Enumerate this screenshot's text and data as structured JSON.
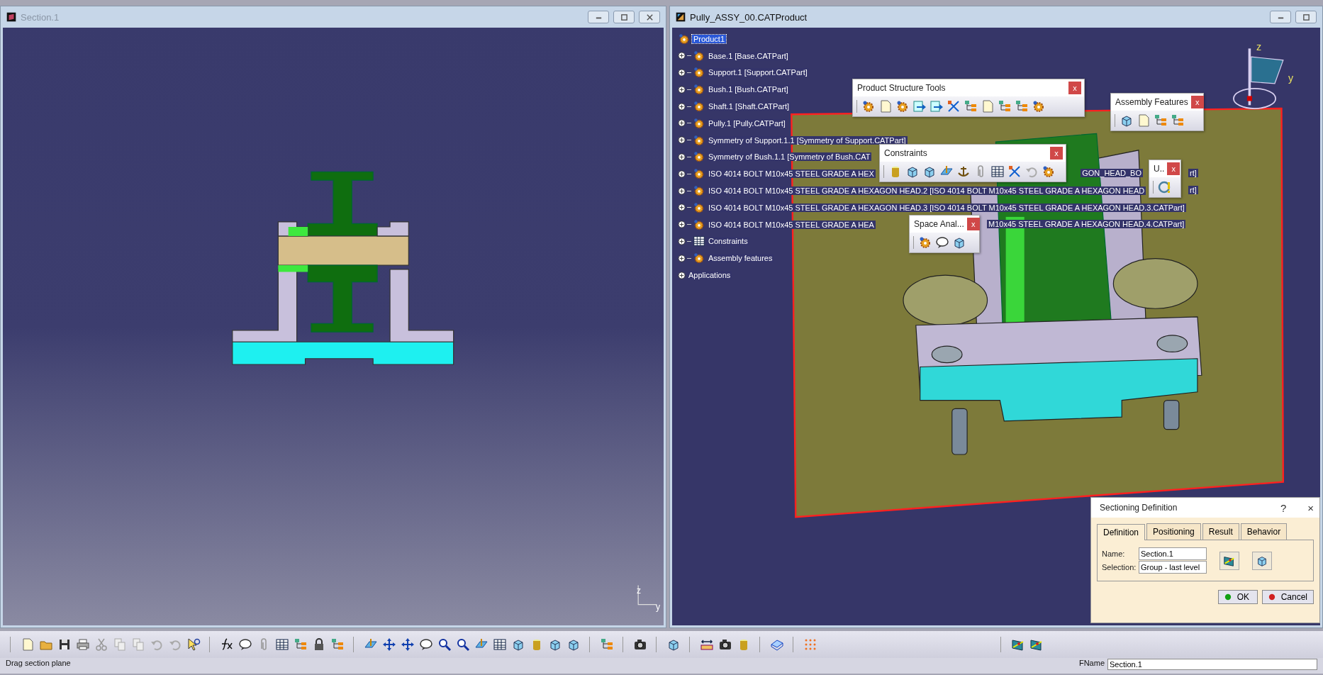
{
  "left_window": {
    "title": "Section.1",
    "axis": {
      "z": "z",
      "y": "y"
    }
  },
  "right_window": {
    "title": "Pully_ASSY_00.CATProduct",
    "tree": [
      {
        "label": "Product1",
        "kind": "product",
        "selected": true,
        "children": [
          {
            "label": "Base.1 [Base.CATPart]",
            "kind": "part",
            "selected": false
          },
          {
            "label": "Support.1 [Support.CATPart]",
            "kind": "part",
            "selected": false
          },
          {
            "label": "Bush.1 [Bush.CATPart]",
            "kind": "part",
            "selected": false
          },
          {
            "label": "Shaft.1 [Shaft.CATPart]",
            "kind": "part",
            "selected": false
          },
          {
            "label": "Pully.1 [Pully.CATPart]",
            "kind": "part",
            "selected": false
          },
          {
            "label": "Symmetry of Support.1.1 [Symmetry of Support.CATPart]",
            "kind": "part",
            "selected": false
          },
          {
            "label": "Symmetry of Bush.1.1 [Symmetry of Bush.CAT",
            "kind": "part",
            "selected": false
          },
          {
            "label": "ISO 4014 BOLT M10x45 STEEL GRADE A HEX",
            "kind": "part",
            "selected": false,
            "tails": [
              {
                "text": "GON_HEAD_BO",
                "kind": "mid"
              },
              {
                "text": "rt]",
                "kind": "end"
              }
            ]
          },
          {
            "label": "ISO 4014 BOLT M10x45 STEEL GRADE A HEXAGON HEAD.2 [ISO 4014 BOLT M10x45 STEEL GRADE A HEXAGON HEAD",
            "kind": "part",
            "selected": false,
            "tails": [
              {
                "text": "rt]",
                "kind": "end"
              }
            ]
          },
          {
            "label": "ISO 4014 BOLT M10x45 STEEL GRADE A HEXAGON HEAD.3 [ISO 4014 BOLT M10x45 STEEL GRADE A HEXAGON HEAD.3.CATPart]",
            "kind": "part",
            "selected": false
          },
          {
            "label": "ISO 4014 BOLT M10x45 STEEL GRADE A HEA",
            "kind": "part",
            "selected": false,
            "tails": [
              {
                "text": "M10x45 STEEL GRADE A HEXAGON HEAD.4.CATPart]",
                "kind": "after"
              }
            ]
          },
          {
            "label": "Constraints",
            "kind": "constraints",
            "selected": false
          },
          {
            "label": "Assembly features",
            "kind": "features",
            "selected": false
          }
        ]
      },
      {
        "label": "Applications",
        "kind": "applications",
        "selected": false
      }
    ],
    "compass": {
      "z": "z",
      "y": "y"
    },
    "floating_toolbars": [
      {
        "title": "Product Structure Tools",
        "close": "x"
      },
      {
        "title": "Assembly Features",
        "close": "x"
      },
      {
        "title": "Constraints",
        "close": "x"
      },
      {
        "title": "U..",
        "close": "x"
      },
      {
        "title": "Space Anal...",
        "close": "x"
      }
    ],
    "dialog": {
      "title": "Sectioning Definition",
      "help": "?",
      "close": "×",
      "tabs": [
        {
          "label": "Definition",
          "selected": true
        },
        {
          "label": "Positioning",
          "selected": false
        },
        {
          "label": "Result",
          "selected": false
        },
        {
          "label": "Behavior",
          "selected": false
        }
      ],
      "name_label": "Name:",
      "name_value": "Section.1",
      "selection_label": "Selection:",
      "selection_value": "Group - last level",
      "buttons": [
        {
          "label": "OK",
          "kind": "ok"
        },
        {
          "label": "Cancel",
          "kind": "cancel"
        }
      ]
    }
  },
  "status_bar": {
    "message": "Drag section plane",
    "field_label": "FName",
    "field_value": "Section.1"
  }
}
